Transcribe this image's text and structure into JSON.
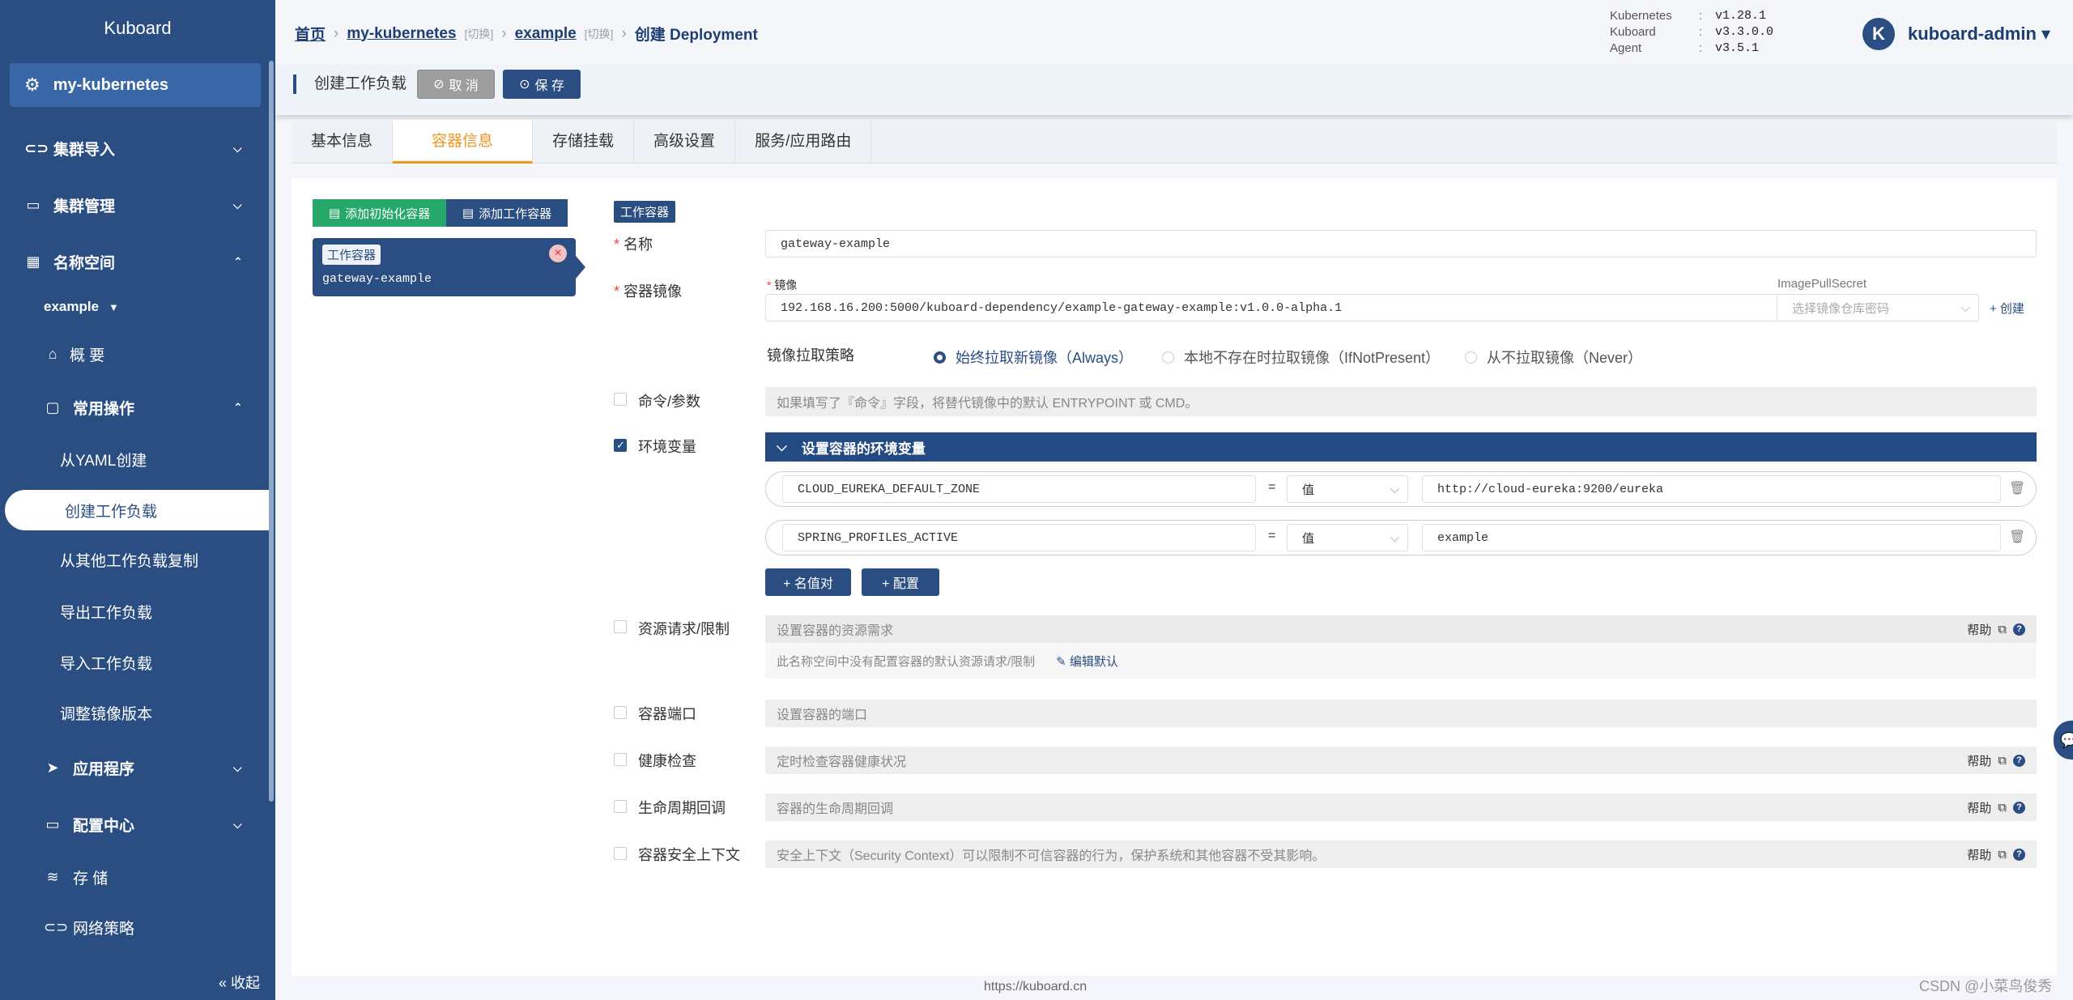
{
  "sidebar": {
    "logo": "Kuboard",
    "cluster": "my-kubernetes",
    "items": [
      {
        "label": "集群导入"
      },
      {
        "label": "集群管理"
      },
      {
        "label": "名称空间"
      },
      {
        "label": "example"
      },
      {
        "label": "概 要"
      },
      {
        "label": "常用操作"
      },
      {
        "label": "从YAML创建"
      },
      {
        "label": "创建工作负载"
      },
      {
        "label": "从其他工作负载复制"
      },
      {
        "label": "导出工作负载"
      },
      {
        "label": "导入工作负载"
      },
      {
        "label": "调整镜像版本"
      },
      {
        "label": "应用程序"
      },
      {
        "label": "配置中心"
      },
      {
        "label": "存 储"
      },
      {
        "label": "网络策略"
      }
    ],
    "collapse": "« 收起"
  },
  "breadcrumb": {
    "home": "首页",
    "cluster": "my-kubernetes",
    "switch": "[切换]",
    "ns": "example",
    "current": "创建 Deployment"
  },
  "versions": [
    {
      "k": "Kubernetes",
      "v": "v1.28.1"
    },
    {
      "k": "Kuboard",
      "v": "v3.3.0.0"
    },
    {
      "k": "Agent",
      "v": "v3.5.1"
    }
  ],
  "user": {
    "avatar": "K",
    "name": "kuboard-admin ▾"
  },
  "toolbar": {
    "title": "创建工作负载",
    "cancel": "取 消",
    "save": "保 存"
  },
  "tabs": [
    "基本信息",
    "容器信息",
    "存储挂载",
    "高级设置",
    "服务/应用路由"
  ],
  "containers": {
    "add_init": "添加初始化容器",
    "add_work": "添加工作容器",
    "card_tag": "工作容器",
    "card_name": "gateway-example"
  },
  "form": {
    "section": "工作容器",
    "name_label": "名称",
    "name_value": "gateway-example",
    "image_label": "容器镜像",
    "image_sub": "镜像",
    "image_value": "192.168.16.200:5000/kuboard-dependency/example-gateway-example:v1.0.0-alpha.1",
    "pull_secret_label": "ImagePullSecret",
    "pull_secret_placeholder": "选择镜像仓库密码",
    "create": "+ 创建",
    "pull_policy_label": "镜像拉取策略",
    "pull_options": [
      "始终拉取新镜像（Always）",
      "本地不存在时拉取镜像（IfNotPresent）",
      "从不拉取镜像（Never）"
    ],
    "cmd_label": "命令/参数",
    "cmd_hint": "如果填写了『命令』字段，将替代镜像中的默认 ENTRYPOINT 或 CMD。",
    "env_label": "环境变量",
    "env_bar": "设置容器的环境变量",
    "env": [
      {
        "key": "CLOUD_EUREKA_DEFAULT_ZONE",
        "eq": "=",
        "type": "值",
        "value": "http://cloud-eureka:9200/eureka"
      },
      {
        "key": "SPRING_PROFILES_ACTIVE",
        "eq": "=",
        "type": "值",
        "value": "example"
      }
    ],
    "add_kv": "+ 名值对",
    "add_cfg": "+ 配置",
    "res_label": "资源请求/限制",
    "res_hint": "设置容器的资源需求",
    "res_note": "此名称空间中没有配置容器的默认资源请求/限制",
    "res_edit": "编辑默认",
    "port_label": "容器端口",
    "port_hint": "设置容器的端口",
    "health_label": "健康检查",
    "health_hint": "定时检查容器健康状况",
    "life_label": "生命周期回调",
    "life_hint": "容器的生命周期回调",
    "sec_label": "容器安全上下文",
    "sec_hint": "安全上下文（Security Context）可以限制不可信容器的行为，保护系统和其他容器不受其影响。",
    "help": "帮助"
  },
  "footer": "https://kuboard.cn",
  "watermark": "CSDN @小菜鸟俊秀"
}
